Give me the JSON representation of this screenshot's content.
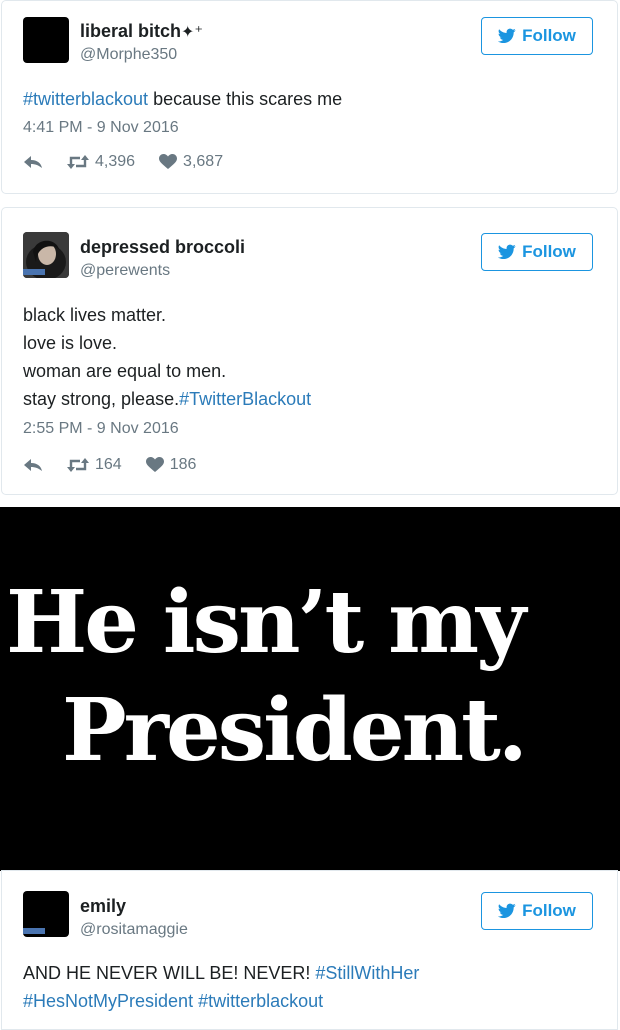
{
  "tweets": [
    {
      "name": "liberal bitch",
      "name_suffix": "✦⁺",
      "handle": "@Morphe350",
      "follow_label": "Follow",
      "text_prefix": "#twitterblackout",
      "text_rest": " because this scares me",
      "timestamp": "4:41 PM - 9 Nov 2016",
      "retweets": "4,396",
      "likes": "3,687"
    },
    {
      "name": "depressed broccoli",
      "handle": "@perewents",
      "follow_label": "Follow",
      "lines": [
        "black lives matter.",
        "love is love.",
        "woman are equal to men.",
        "stay strong, please."
      ],
      "line4_hashtag": "#TwitterBlackout",
      "timestamp": "2:55 PM - 9 Nov 2016",
      "retweets": "164",
      "likes": "186"
    },
    {
      "name": "emily",
      "handle": "@rositamaggie",
      "follow_label": "Follow",
      "line1_text": "AND HE NEVER WILL BE! NEVER! ",
      "line1_hashtag": "#StillWithHer",
      "line2_hashtag1": "#HesNotMyPresident",
      "line2_space": " ",
      "line2_hashtag2": "#twitterblackout"
    }
  ],
  "banner": {
    "line1": "He isn’t my",
    "line2": "President."
  },
  "icons": {
    "reply": "reply-icon",
    "retweet": "retweet-icon",
    "like": "heart-icon",
    "bird": "twitter-bird-icon"
  },
  "colors": {
    "link": "#2b7bb9",
    "follow": "#1b95e0",
    "muted": "#697882"
  }
}
